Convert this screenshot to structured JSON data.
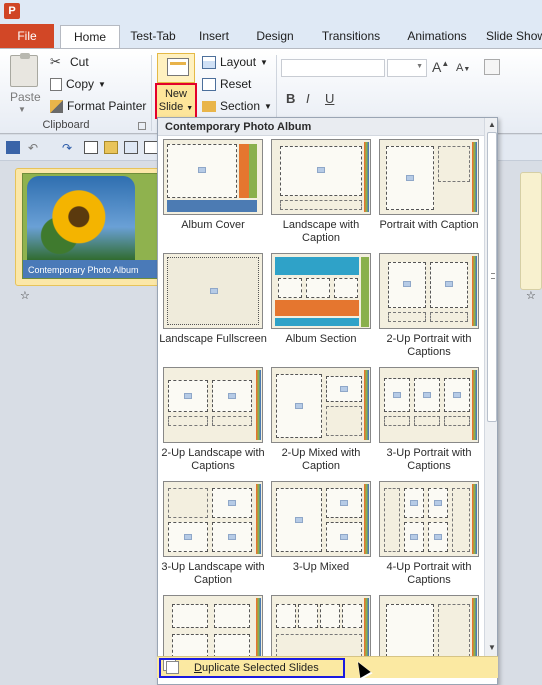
{
  "tabs": {
    "file": "File",
    "home": "Home",
    "test_tab": "Test-Tab",
    "insert": "Insert",
    "design": "Design",
    "transitions": "Transitions",
    "animations": "Animations",
    "slide_show": "Slide Show"
  },
  "ribbon": {
    "clipboard": {
      "paste": "Paste",
      "cut": "Cut",
      "copy": "Copy",
      "format_painter": "Format Painter",
      "group_label": "Clipboard"
    },
    "slides": {
      "new_slide_line1": "New",
      "new_slide_line2": "Slide",
      "layout": "Layout",
      "reset": "Reset",
      "section": "Section"
    },
    "font": {
      "bold": "B",
      "italic": "I",
      "underline": "U"
    }
  },
  "slide_pane": {
    "thumbnail_caption": "Contemporary Photo Album",
    "star": "☆"
  },
  "gallery": {
    "header": "Contemporary Photo Album",
    "layouts": [
      {
        "label": "Album Cover"
      },
      {
        "label": "Landscape with Caption"
      },
      {
        "label": "Portrait with Caption"
      },
      {
        "label": "Landscape Fullscreen"
      },
      {
        "label": "Album Section"
      },
      {
        "label": "2-Up Portrait with Captions"
      },
      {
        "label": "2-Up Landscape with Captions"
      },
      {
        "label": "2-Up Mixed with Caption"
      },
      {
        "label": "3-Up Portrait with Captions"
      },
      {
        "label": "3-Up Landscape with Caption"
      },
      {
        "label": "3-Up Mixed"
      },
      {
        "label": "4-Up Portrait with Captions"
      }
    ],
    "duplicate_prefix": "D",
    "duplicate_rest": "uplicate Selected Slides"
  },
  "colors": {
    "file_tab": "#d24726",
    "highlight": "#fbe9a2",
    "red_outline": "#e4002b",
    "blue_outline": "#1a1ae0"
  }
}
